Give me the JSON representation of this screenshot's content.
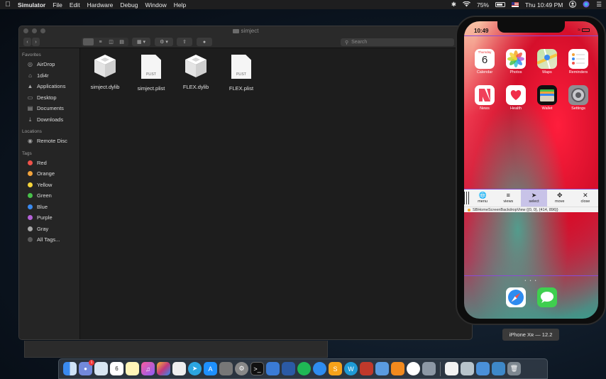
{
  "menubar": {
    "apple": "",
    "items": [
      "Simulator",
      "File",
      "Edit",
      "Hardware",
      "Debug",
      "Window",
      "Help"
    ],
    "battery": "75%",
    "clock": "Thu 10:49 PM"
  },
  "finder": {
    "title": "simject",
    "search_placeholder": "Search",
    "sidebar": {
      "favorites_label": "Favorites",
      "favorites": [
        "AirDrop",
        "1di4r",
        "Applications",
        "Desktop",
        "Documents",
        "Downloads"
      ],
      "locations_label": "Locations",
      "locations": [
        "Remote Disc"
      ],
      "tags_label": "Tags",
      "tags": [
        {
          "name": "Red",
          "color": "#f0524a"
        },
        {
          "name": "Orange",
          "color": "#f3a33b"
        },
        {
          "name": "Yellow",
          "color": "#f5d43a"
        },
        {
          "name": "Green",
          "color": "#47c04a"
        },
        {
          "name": "Blue",
          "color": "#3a8af0"
        },
        {
          "name": "Purple",
          "color": "#b562d8"
        },
        {
          "name": "Gray",
          "color": "#a8a8a8"
        }
      ],
      "all_tags": "All Tags..."
    },
    "files": [
      {
        "name": "simject.dylib",
        "kind": "dylib"
      },
      {
        "name": "simject.plist",
        "kind": "plist",
        "badge": "PLIST"
      },
      {
        "name": "FLEX.dylib",
        "kind": "dylib"
      },
      {
        "name": "FLEX.plist",
        "kind": "plist",
        "badge": "PLIST"
      }
    ]
  },
  "simulator": {
    "status_time": "10:49",
    "apps": [
      {
        "label": "Calendar",
        "day_name": "Thursday",
        "day": "6"
      },
      {
        "label": "Photos"
      },
      {
        "label": "Maps"
      },
      {
        "label": "Reminders"
      },
      {
        "label": "News"
      },
      {
        "label": "Health"
      },
      {
        "label": "Wallet"
      },
      {
        "label": "Settings"
      }
    ],
    "flex_toolbar": {
      "buttons": [
        "menu",
        "views",
        "select",
        "move",
        "close"
      ],
      "info": "SBHomeScreenBackdropView {{0, 0}, {414, 896}}"
    },
    "page_dots": "• • •",
    "device_label": "iPhone Xʀ — 12.2"
  },
  "dock": {
    "calendar_day": "6",
    "discord_badge": "1"
  }
}
